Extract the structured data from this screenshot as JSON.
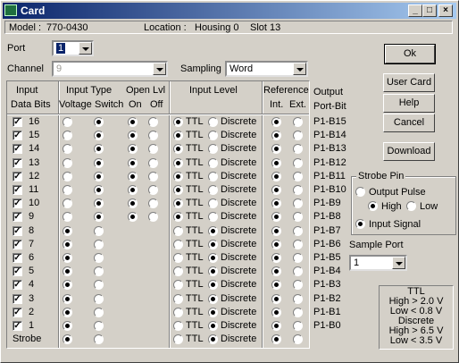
{
  "window": {
    "title": "Card"
  },
  "info": {
    "model_label": "Model :",
    "model": "770-0430",
    "location_label": "Location :",
    "location": "Housing  0",
    "slot": "Slot  13"
  },
  "port": {
    "label": "Port",
    "value": "1"
  },
  "channel": {
    "label": "Channel",
    "value": "9"
  },
  "sampling": {
    "label": "Sampling",
    "value": "Word"
  },
  "buttons": {
    "ok": "Ok",
    "user_card": "User Card",
    "help": "Help",
    "cancel": "Cancel",
    "download": "Download"
  },
  "headers": {
    "input": "Input",
    "data_bits": "Data Bits",
    "input_type": "Input Type",
    "voltage": "Voltage",
    "switch": "Switch",
    "open_lvl": "Open Lvl",
    "on": "On",
    "off": "Off",
    "input_level": "Input Level",
    "reference": "Reference",
    "int": "Int.",
    "ext": "Ext.",
    "output": "Output",
    "port_bit": "Port-Bit"
  },
  "level_labels": {
    "ttl": "TTL",
    "discrete": "Discrete"
  },
  "rows": [
    {
      "bit": "16",
      "checked": true,
      "type": "switch",
      "open": "on",
      "level": "ttl",
      "ref": "int",
      "out": "P1-B15"
    },
    {
      "bit": "15",
      "checked": true,
      "type": "switch",
      "open": "on",
      "level": "ttl",
      "ref": "int",
      "out": "P1-B14"
    },
    {
      "bit": "14",
      "checked": true,
      "type": "switch",
      "open": "on",
      "level": "ttl",
      "ref": "int",
      "out": "P1-B13"
    },
    {
      "bit": "13",
      "checked": true,
      "type": "switch",
      "open": "on",
      "level": "ttl",
      "ref": "int",
      "out": "P1-B12"
    },
    {
      "bit": "12",
      "checked": true,
      "type": "switch",
      "open": "on",
      "level": "ttl",
      "ref": "int",
      "out": "P1-B11"
    },
    {
      "bit": "11",
      "checked": true,
      "type": "switch",
      "open": "on",
      "level": "ttl",
      "ref": "int",
      "out": "P1-B10"
    },
    {
      "bit": "10",
      "checked": true,
      "type": "switch",
      "open": "on",
      "level": "ttl",
      "ref": "int",
      "out": "P1-B9"
    },
    {
      "bit": "9",
      "checked": true,
      "type": "switch",
      "open": "on",
      "level": "ttl",
      "ref": "int",
      "out": "P1-B8"
    },
    {
      "bit": "8",
      "checked": true,
      "type": "voltage",
      "open": "",
      "level": "discrete",
      "ref": "int",
      "out": "P1-B7"
    },
    {
      "bit": "7",
      "checked": true,
      "type": "voltage",
      "open": "",
      "level": "discrete",
      "ref": "int",
      "out": "P1-B6"
    },
    {
      "bit": "6",
      "checked": true,
      "type": "voltage",
      "open": "",
      "level": "discrete",
      "ref": "int",
      "out": "P1-B5"
    },
    {
      "bit": "5",
      "checked": true,
      "type": "voltage",
      "open": "",
      "level": "discrete",
      "ref": "int",
      "out": "P1-B4"
    },
    {
      "bit": "4",
      "checked": true,
      "type": "voltage",
      "open": "",
      "level": "discrete",
      "ref": "int",
      "out": "P1-B3"
    },
    {
      "bit": "3",
      "checked": true,
      "type": "voltage",
      "open": "",
      "level": "discrete",
      "ref": "int",
      "out": "P1-B2"
    },
    {
      "bit": "2",
      "checked": true,
      "type": "voltage",
      "open": "",
      "level": "discrete",
      "ref": "int",
      "out": "P1-B1"
    },
    {
      "bit": "1",
      "checked": true,
      "type": "voltage",
      "open": "",
      "level": "discrete",
      "ref": "int",
      "out": "P1-B0"
    },
    {
      "bit": "Strobe",
      "checked": null,
      "type": "voltage",
      "open": "",
      "level": "discrete",
      "ref": "int",
      "out": ""
    }
  ],
  "strobe_pin": {
    "title": "Strobe Pin",
    "output_pulse": "Output Pulse",
    "high": "High",
    "low": "Low",
    "input_signal": "Input Signal",
    "selected": "input_signal",
    "pulse_level": "high"
  },
  "sample_port": {
    "label": "Sample Port",
    "value": "1"
  },
  "legend_lines": [
    "TTL",
    "High > 2.0 V",
    "Low < 0.8 V",
    "Discrete",
    "High > 6.5 V",
    "Low < 3.5 V"
  ]
}
